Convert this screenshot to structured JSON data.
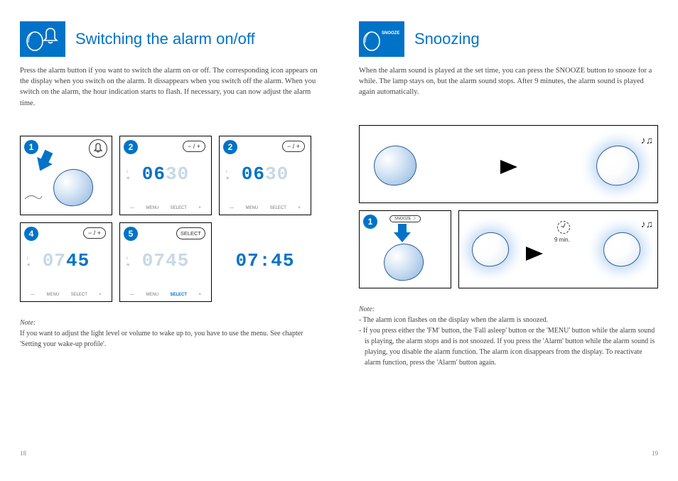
{
  "left": {
    "title": "Switching the alarm on/off",
    "intro": "Press the alarm button if you want to switch the alarm on or off. The corresponding icon appears on the display when you switch on the alarm. It dissappears when you switch off the alarm. When you switch on the alarm, the hour indication starts to flash. If necessary, you can now adjust the alarm time.",
    "steps": {
      "s1_num": "1",
      "s2_num": "2",
      "s2_btn": "− / +",
      "s2_time_active": "06",
      "s2_time_dim": "30",
      "s3_num": "2",
      "s3_btn": "− / +",
      "s3_time_active": "06",
      "s3_time_dim": "30",
      "s4_num": "4",
      "s4_btn": "− / +",
      "s4_time_dim1": "07",
      "s4_time_active": "45",
      "s5_num": "5",
      "s5_btn": "SELECT",
      "s5_time_dim1": "07",
      "s5_time_dim2": "45",
      "s6_time": "07:45"
    },
    "menu_labels": {
      "a": "—",
      "b": "MENU",
      "c": "SELECT",
      "d": "+"
    },
    "note_head": "Note:",
    "note_body": "If you want to adjust the light level or volume to wake up to, you have to use the menu. See chapter 'Setting your wake-up profile'.",
    "page_num": "18"
  },
  "right": {
    "icon_label": "SNOOZE",
    "title": "Snoozing",
    "intro": "When the alarm sound is played at the set time, you can press the SNOOZE button to snooze for a while. The lamp stays on, but the alarm sound stops.  After 9 minutes, the alarm sound is played again automatically.",
    "step_num": "1",
    "snooze_pill": "SNOOZE  ☽",
    "nine_min": "9 min.",
    "note_head": "Note:",
    "note_line1": "- The alarm icon flashes on the display when the alarm is snoozed.",
    "note_line2": "- If you press either the 'FM' button, the 'Fall asleep' button or the 'MENU' button while the alarm sound is playing, the alarm stops and is not snoozed. If you press the 'Alarm' button while the alarm sound is playing, you disable the alarm function. The alarm icon disappears from the display. To reactivate alarm function, press the 'Alarm' button again.",
    "page_num": "19"
  }
}
